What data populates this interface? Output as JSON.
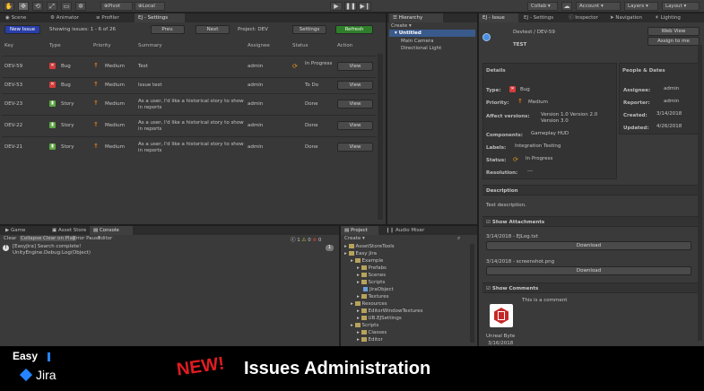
{
  "topbar": {
    "tools": [
      "✋",
      "✥",
      "⟲",
      "⤢",
      "▭",
      "✲"
    ],
    "pivot": "Pivot",
    "local": "Local",
    "collab": "Collab",
    "account": "Account",
    "layers": "Layers",
    "layout": "Layout",
    "cloud_icon": "cloud-icon"
  },
  "left_tabs": [
    {
      "label": "Scene"
    },
    {
      "label": "Animator"
    },
    {
      "label": "Profiler"
    },
    {
      "label": "EJ - Settings"
    }
  ],
  "issues": {
    "new_issue": "New Issue",
    "showing": "Showing issues: 1 - 6 of 26",
    "prev": "Prev.",
    "next": "Next",
    "project": "Project: DEV",
    "settings": "Settings",
    "refresh": "Refresh",
    "columns": {
      "key": "Key",
      "type": "Type",
      "priority": "Priority",
      "summary": "Summary",
      "assignee": "Assignee",
      "status": "Status",
      "action": "Action"
    },
    "rows": [
      {
        "key": "DEV-59",
        "type": "Bug",
        "priority": "Medium",
        "summary": "Test",
        "assignee": "admin",
        "status": "In Progress",
        "action": "View"
      },
      {
        "key": "DEV-53",
        "type": "Bug",
        "priority": "Medium",
        "summary": "Issue test",
        "assignee": "admin",
        "status": "To Do",
        "action": "View"
      },
      {
        "key": "DEV-23",
        "type": "Story",
        "priority": "Medium",
        "summary": "As a user, I'd like a historical story to show in reports",
        "assignee": "admin",
        "status": "Done",
        "action": "View"
      },
      {
        "key": "DEV-22",
        "type": "Story",
        "priority": "Medium",
        "summary": "As a user, I'd like a historical story to show in reports",
        "assignee": "admin",
        "status": "Done",
        "action": "View"
      },
      {
        "key": "DEV-21",
        "type": "Story",
        "priority": "Medium",
        "summary": "As a user, I'd like a historical story to show in reports",
        "assignee": "admin",
        "status": "Done",
        "action": "View"
      }
    ]
  },
  "hierarchy": {
    "tab": "Hierarchy",
    "create": "Create",
    "root": "Untitled",
    "items": [
      "Main Camera",
      "Directional Light"
    ]
  },
  "right_tabs": [
    {
      "label": "EJ - Issue"
    },
    {
      "label": "EJ - Settings"
    },
    {
      "label": "Inspector"
    },
    {
      "label": "Navigation"
    },
    {
      "label": "Lighting"
    }
  ],
  "issue": {
    "path": "Devtest / DEV-59",
    "title": "TEST",
    "web_view": "Web View",
    "assign_to_me": "Assign to me",
    "details_title": "Details",
    "people_title": "People & Dates",
    "type_label": "Type:",
    "type_value": "Bug",
    "priority_label": "Priority:",
    "priority_value": "Medium",
    "affect_label": "Affect versions:",
    "affect_value": "Version 1.0 Version 2.0 Version 3.0",
    "components_label": "Components:",
    "components_value": "Gameplay HUD",
    "labels_label": "Labels:",
    "labels_value": "Integration Testing",
    "status_label": "Status:",
    "status_value": "In Progress",
    "resolution_label": "Resolution:",
    "resolution_value": "---",
    "assignee_label": "Assignee:",
    "assignee_value": "admin",
    "reporter_label": "Reporter:",
    "reporter_value": "admin",
    "created_label": "Created:",
    "created_value": "3/14/2018",
    "updated_label": "Updated:",
    "updated_value": "4/26/2018",
    "description_title": "Description",
    "description_value": "Test description.",
    "attachments_title": "Show Attachments",
    "attachment1": "3/14/2018 - EJLog.txt",
    "attachment2": "3/14/2018 - screenshot.png",
    "download": "Download",
    "comments_title": "Show Comments",
    "comment_text": "This is a comment",
    "comment_author": "Unreal Byte",
    "comment_date": "3/16/2018"
  },
  "console": {
    "tabs": [
      {
        "label": "Game"
      },
      {
        "label": "Asset Store"
      },
      {
        "label": "Console"
      }
    ],
    "toolbar": [
      "Clear",
      "Collapse",
      "Clear on Play",
      "Error Pause",
      "Editor"
    ],
    "counts": [
      "1",
      "0",
      "0"
    ],
    "line1": "[EasyJira] Search complete!",
    "line2": "UnityEngine.Debug:Log(Object)",
    "badge": "1"
  },
  "project": {
    "tabs": [
      {
        "label": "Project"
      },
      {
        "label": "Audio Mixer"
      }
    ],
    "create": "Create",
    "tree": [
      {
        "label": "AssetStoreTools",
        "indent": 0
      },
      {
        "label": "Easy Jira",
        "indent": 0
      },
      {
        "label": "Example",
        "indent": 1
      },
      {
        "label": "Prefabs",
        "indent": 2
      },
      {
        "label": "Scenes",
        "indent": 2
      },
      {
        "label": "Scripts",
        "indent": 2
      },
      {
        "label": "JiraObject",
        "indent": 3
      },
      {
        "label": "Textures",
        "indent": 2
      },
      {
        "label": "Resources",
        "indent": 1
      },
      {
        "label": "EditorWindowTextures",
        "indent": 2
      },
      {
        "label": "UB.EJSettings",
        "indent": 2
      },
      {
        "label": "Scripts",
        "indent": 1
      },
      {
        "label": "Classes",
        "indent": 2
      },
      {
        "label": "Editor",
        "indent": 2
      }
    ]
  },
  "banner": {
    "easy": "Easy",
    "jira": "Jira",
    "new": "NEW!",
    "headline": "Issues Administration",
    "colors": {
      "new": "#e11b22",
      "jira_blue": "#2684ff"
    }
  }
}
